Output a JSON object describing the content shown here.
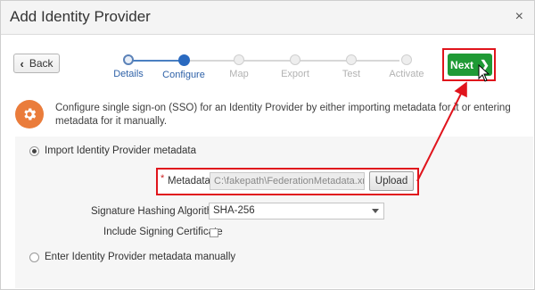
{
  "dialog": {
    "title": "Add Identity Provider",
    "close_glyph": "×"
  },
  "nav": {
    "back_label": "Back",
    "next_label": "Next"
  },
  "steps": [
    {
      "label": "Details",
      "state": "visited"
    },
    {
      "label": "Configure",
      "state": "current"
    },
    {
      "label": "Map",
      "state": "upcoming"
    },
    {
      "label": "Export",
      "state": "upcoming"
    },
    {
      "label": "Test",
      "state": "upcoming"
    },
    {
      "label": "Activate",
      "state": "upcoming"
    }
  ],
  "description": "Configure single sign-on (SSO) for an Identity Provider by either importing metadata for it or entering metadata for it manually.",
  "options": {
    "import_label": "Import Identity Provider metadata",
    "import_selected": true,
    "manual_label": "Enter Identity Provider metadata manually",
    "manual_selected": false
  },
  "metadata": {
    "required_mark": "*",
    "label": "Metadata",
    "value": "C:\\fakepath\\FederationMetadata.xml",
    "upload_label": "Upload"
  },
  "hashing": {
    "label": "Signature Hashing Algorithm",
    "value": "SHA-256"
  },
  "signing": {
    "label": "Include Signing Certificate",
    "checked": false
  },
  "colors": {
    "accent": "#1f9a35",
    "highlight": "#e0141c",
    "icon_bg": "#ea7c3b",
    "step_active": "#2a6ac0"
  },
  "icons": {
    "back": "chevron-left-icon",
    "next": "chevron-right-icon",
    "info": "gear-icon",
    "close": "close-icon"
  }
}
